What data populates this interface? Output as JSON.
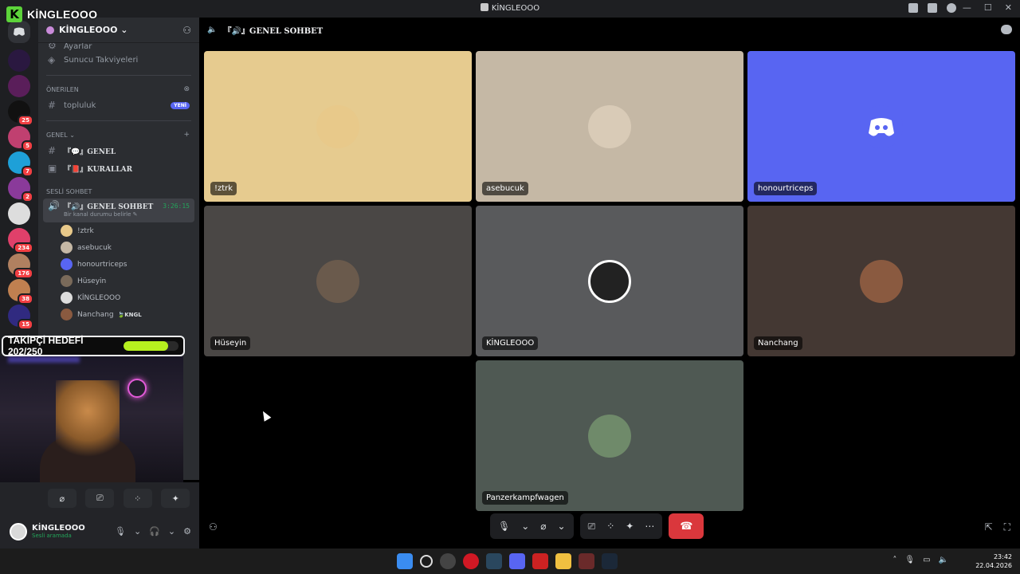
{
  "app": {
    "window_title": "KİNGLEOOO",
    "overlay_name": "KİNGLEOOO",
    "overlay_letter": "K"
  },
  "servers": [
    {
      "badge": ""
    },
    {
      "badge": ""
    },
    {
      "badge": "25"
    },
    {
      "badge": "5"
    },
    {
      "badge": "7"
    },
    {
      "badge": "2"
    },
    {
      "badge": ""
    },
    {
      "badge": "234"
    },
    {
      "badge": "176"
    },
    {
      "badge": "38"
    },
    {
      "badge": "15"
    }
  ],
  "guild": {
    "name": "KİNGLEOOO ⌄",
    "boosts": "Sunucu Takviyeleri",
    "partial_top": "Ayarlar"
  },
  "suggested": {
    "title": "Önerilen",
    "channel": "topluluk",
    "badge": "YENİ"
  },
  "general": {
    "title": "GENEL ⌄",
    "add": "+",
    "channels": [
      {
        "label": "『💬』GENEL"
      },
      {
        "label": "『📕』KURALLAR"
      }
    ]
  },
  "voice": {
    "title": "SESLİ SOHBET",
    "channel": "『🔊』GENEL SOHBET",
    "timer": "3:26:15",
    "status": "Bir kanal durumu belirle ✎",
    "members": [
      {
        "name": "!ztrk",
        "color": "#e8c98a",
        "tag": ""
      },
      {
        "name": "asebucuk",
        "color": "#c5b8a5",
        "tag": ""
      },
      {
        "name": "honourtriceps",
        "color": "#5865f2",
        "tag": ""
      },
      {
        "name": "Hüseyin",
        "color": "#7a6a5a",
        "tag": ""
      },
      {
        "name": "KİNGLEOOO",
        "color": "#dddddd",
        "tag": ""
      },
      {
        "name": "Nanchang",
        "color": "#8a5a40",
        "tag": "🍃KNGL"
      }
    ]
  },
  "follow_goal": {
    "label": "TAKİPÇİ HEDEFİ 202/250",
    "progress": 0.808
  },
  "user": {
    "name": "KİNGLEOOO",
    "status": "Sesli aramada"
  },
  "main": {
    "header": "『🔊』GENEL SOHBET",
    "tiles": [
      {
        "name": "!ztrk",
        "bg": "#e6cb8f",
        "avatar": "#e8c98a"
      },
      {
        "name": "asebucuk",
        "bg": "#c5b8a5",
        "avatar": "#d9cbb7"
      },
      {
        "name": "honourtriceps",
        "bg": "#5865f2",
        "avatar": "#5865f2"
      },
      {
        "name": "Hüseyin",
        "bg": "#4a4745",
        "avatar": "#6a5a4c"
      },
      {
        "name": "KİNGLEOOO",
        "bg": "#595a5c",
        "avatar": "#ffffff"
      },
      {
        "name": "Nanchang",
        "bg": "#443833",
        "avatar": "#8a5a40"
      },
      {
        "name": "Panzerkampfwagen",
        "bg": "#4f5953",
        "avatar": "#6f8a6a"
      }
    ]
  },
  "taskbar": {
    "time": "23:42",
    "date": "22.04.2026"
  },
  "colors": {
    "accent": "#5865f2",
    "danger": "#da373c",
    "online": "#23a55a",
    "goal_fill": "#b6f01f"
  }
}
